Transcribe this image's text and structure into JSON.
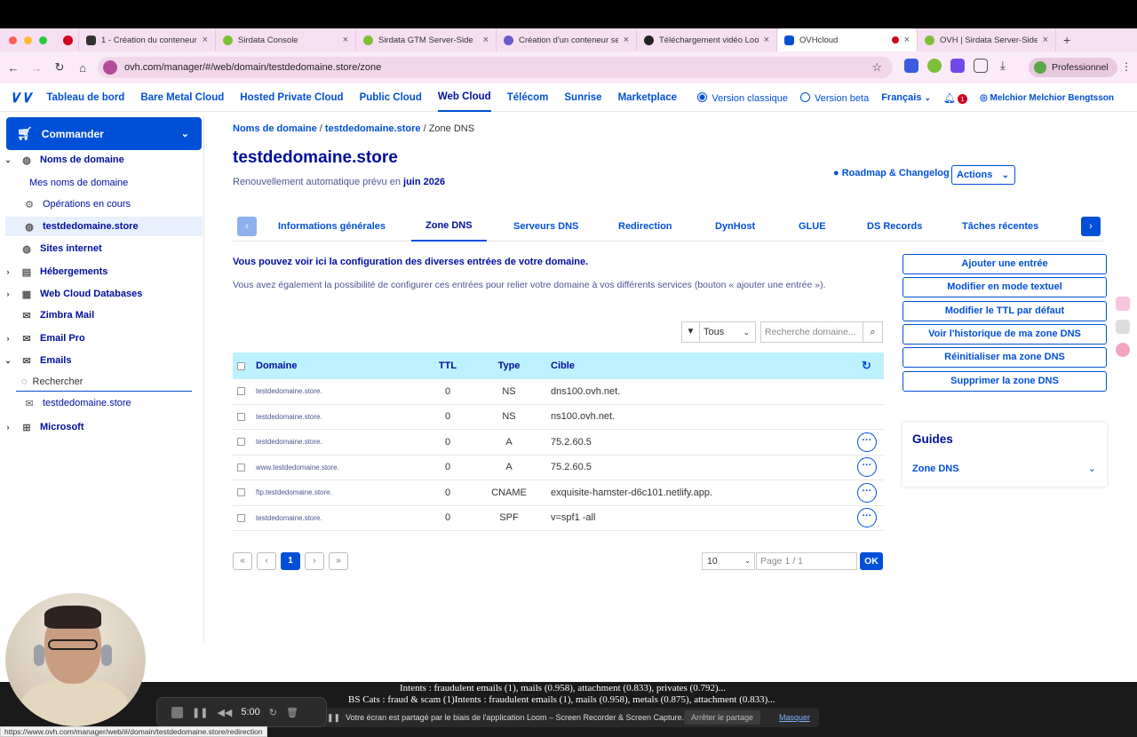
{
  "browser": {
    "tabs": [
      {
        "title": "1 - Création du conteneur ...",
        "icon": "github-icon",
        "color": "#333333"
      },
      {
        "title": "Sirdata Console",
        "icon": "sirdata-icon",
        "color": "#7bbf3a"
      },
      {
        "title": "Sirdata GTM Server-Side",
        "icon": "sirdata-icon",
        "color": "#7bbf3a"
      },
      {
        "title": "Création d'un conteneur se...",
        "icon": "gear-icon",
        "color": "#6a5acd"
      },
      {
        "title": "Téléchargement vidéo Loo...",
        "icon": "record-icon",
        "color": "#222222"
      },
      {
        "title": "OVHcloud",
        "icon": "ovh-icon",
        "color": "#0050d7"
      },
      {
        "title": "OVH | Sirdata Server-Side",
        "icon": "sirdata-icon",
        "color": "#7bbf3a"
      }
    ],
    "active_tab_index": 5,
    "url": "ovh.com/manager/#/web/domain/testdedomaine.store/zone",
    "profile_label": "Professionnel"
  },
  "topnav": {
    "items": [
      "Tableau de bord",
      "Bare Metal Cloud",
      "Hosted Private Cloud",
      "Public Cloud",
      "Web Cloud",
      "Télécom",
      "Sunrise",
      "Marketplace"
    ],
    "active": "Web Cloud",
    "version_classic": "Version classique",
    "version_beta": "Version beta",
    "language": "Français",
    "notifications_count": "1",
    "user": "Melchior Melchior Bengtsson"
  },
  "sidebar": {
    "order_button": "Commander",
    "items": [
      {
        "label": "Noms de domaine",
        "icon": "globe-icon"
      },
      {
        "label": "Mes noms de domaine",
        "icon": ""
      },
      {
        "label": "Opérations en cours",
        "icon": "gear-icon"
      },
      {
        "label": "testdedomaine.store",
        "icon": "globe-icon"
      },
      {
        "label": "Sites internet",
        "icon": "globe-icon"
      },
      {
        "label": "Hébergements",
        "icon": "server-icon"
      },
      {
        "label": "Web Cloud Databases",
        "icon": "database-icon"
      },
      {
        "label": "Zimbra Mail",
        "icon": "mail-icon"
      },
      {
        "label": "Email Pro",
        "icon": "mail-icon"
      },
      {
        "label": "Emails",
        "icon": "mail-icon"
      },
      {
        "label": "testdedomaine.store",
        "icon": "mail-icon"
      },
      {
        "label": "Microsoft",
        "icon": "windows-icon"
      }
    ],
    "search_placeholder": "Rechercher"
  },
  "main": {
    "breadcrumb": [
      "Noms de domaine",
      "testdedomaine.store",
      "Zone DNS"
    ],
    "title": "testdedomaine.store",
    "renew_prefix": "Renouvellement automatique prévu en",
    "renew_date": "juin 2026",
    "roadmap": "Roadmap & Changelog",
    "actions": "Actions",
    "tabs": [
      "Informations générales",
      "Zone DNS",
      "Serveurs DNS",
      "Redirection",
      "DynHost",
      "GLUE",
      "DS Records",
      "Tâches récentes"
    ],
    "active_tab": "Zone DNS",
    "intro_bold": "Vous pouvez voir ici la configuration des diverses entrées de votre domaine.",
    "intro_text": "Vous avez également la possibilité de configurer ces entrées pour relier votre domaine à vos différents services (bouton « ajouter une entrée »).",
    "filter_value": "Tous",
    "search_placeholder": "Recherche domaine...",
    "table": {
      "headers": {
        "domain": "Domaine",
        "ttl": "TTL",
        "type": "Type",
        "target": "Cible"
      },
      "rows": [
        {
          "domain": "testdedomaine.store.",
          "ttl": "0",
          "type": "NS",
          "target": "dns100.ovh.net.",
          "menu": false
        },
        {
          "domain": "testdedomaine.store.",
          "ttl": "0",
          "type": "NS",
          "target": "ns100.ovh.net.",
          "menu": false
        },
        {
          "domain": "testdedomaine.store.",
          "ttl": "0",
          "type": "A",
          "target": "75.2.60.5",
          "menu": true
        },
        {
          "domain": "www.testdedomaine.store.",
          "ttl": "0",
          "type": "A",
          "target": "75.2.60.5",
          "menu": true
        },
        {
          "domain": "ftp.testdedomaine.store.",
          "ttl": "0",
          "type": "CNAME",
          "target": "exquisite-hamster-d6c101.netlify.app.",
          "menu": true
        },
        {
          "domain": "testdedomaine.store.",
          "ttl": "0",
          "type": "SPF",
          "target": "v=spf1 -all",
          "menu": true
        }
      ]
    },
    "pagination": {
      "current_page": "1",
      "per_page": "10",
      "page_label": "Page 1 / 1",
      "ok": "OK"
    },
    "right_buttons": [
      "Ajouter une entrée",
      "Modifier en mode textuel",
      "Modifier le TTL par défaut",
      "Voir l'historique de ma zone DNS",
      "Réinitialiser ma zone DNS",
      "Supprimer la zone DNS"
    ],
    "guides_title": "Guides",
    "guides_item": "Zone DNS"
  },
  "overlay": {
    "subtitle_1": "Intents : fraudulent emails (1), mails (0.958), attachment (0.833), privates (0.792)...",
    "subtitle_2": "BS Cats : fraud & scam (1)Intents : fraudulent emails (1), mails (0.958), metals (0.875), attachment (0.833)...",
    "share_text": "Votre écran est partagé par le biais de l'application Loom – Screen Recorder & Screen Capture.",
    "share_stop": "Arrêter le partage",
    "share_hide": "Masquer",
    "loom_time": "5:00",
    "status_url": "https://www.ovh.com/manager/web/#/domain/testdedomaine.store/redirection"
  },
  "colors": {
    "accent": "#0050d7",
    "header_blue": "#000e9c",
    "table_header_bg": "#bef1ff",
    "tabbar_bg": "#f6dff1"
  }
}
